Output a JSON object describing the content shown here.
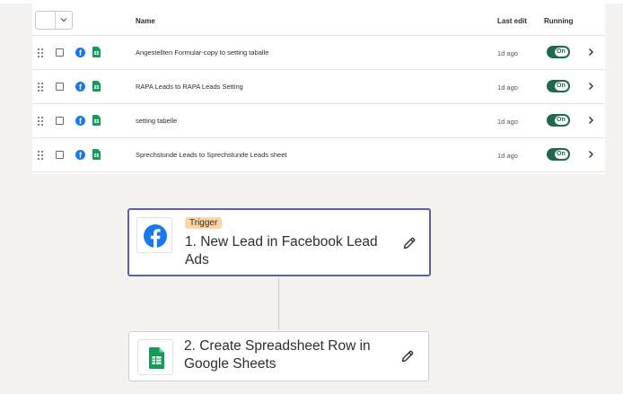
{
  "table": {
    "headers": {
      "name": "Name",
      "last_edit": "Last edit",
      "running": "Running"
    },
    "rows": [
      {
        "name": "Angestellten Formular-copy to setting taballe",
        "last_edit": "1d ago",
        "status": "On"
      },
      {
        "name": "RAPA Leads to RAPA Leads Setting",
        "last_edit": "1d ago",
        "status": "On"
      },
      {
        "name": "setting tabelle",
        "last_edit": "1d ago",
        "status": "On"
      },
      {
        "name": "Sprechstunde Leads to Sprechstunde Leads sheet",
        "last_edit": "1d ago",
        "status": "On"
      }
    ]
  },
  "workflow": {
    "trigger": {
      "badge": "Trigger",
      "title": "1. New Lead in Facebook Lead Ads",
      "icon": "facebook-icon"
    },
    "action": {
      "title": "2. Create Spreadsheet Row in Google Sheets",
      "icon": "google-sheets-icon"
    }
  },
  "colors": {
    "accent_green": "#1d6b4e",
    "facebook_blue": "#1877f2",
    "sheets_green": "#0f9d58",
    "trigger_badge": "#fdd5a0",
    "selected_border": "#5f5fa6"
  }
}
